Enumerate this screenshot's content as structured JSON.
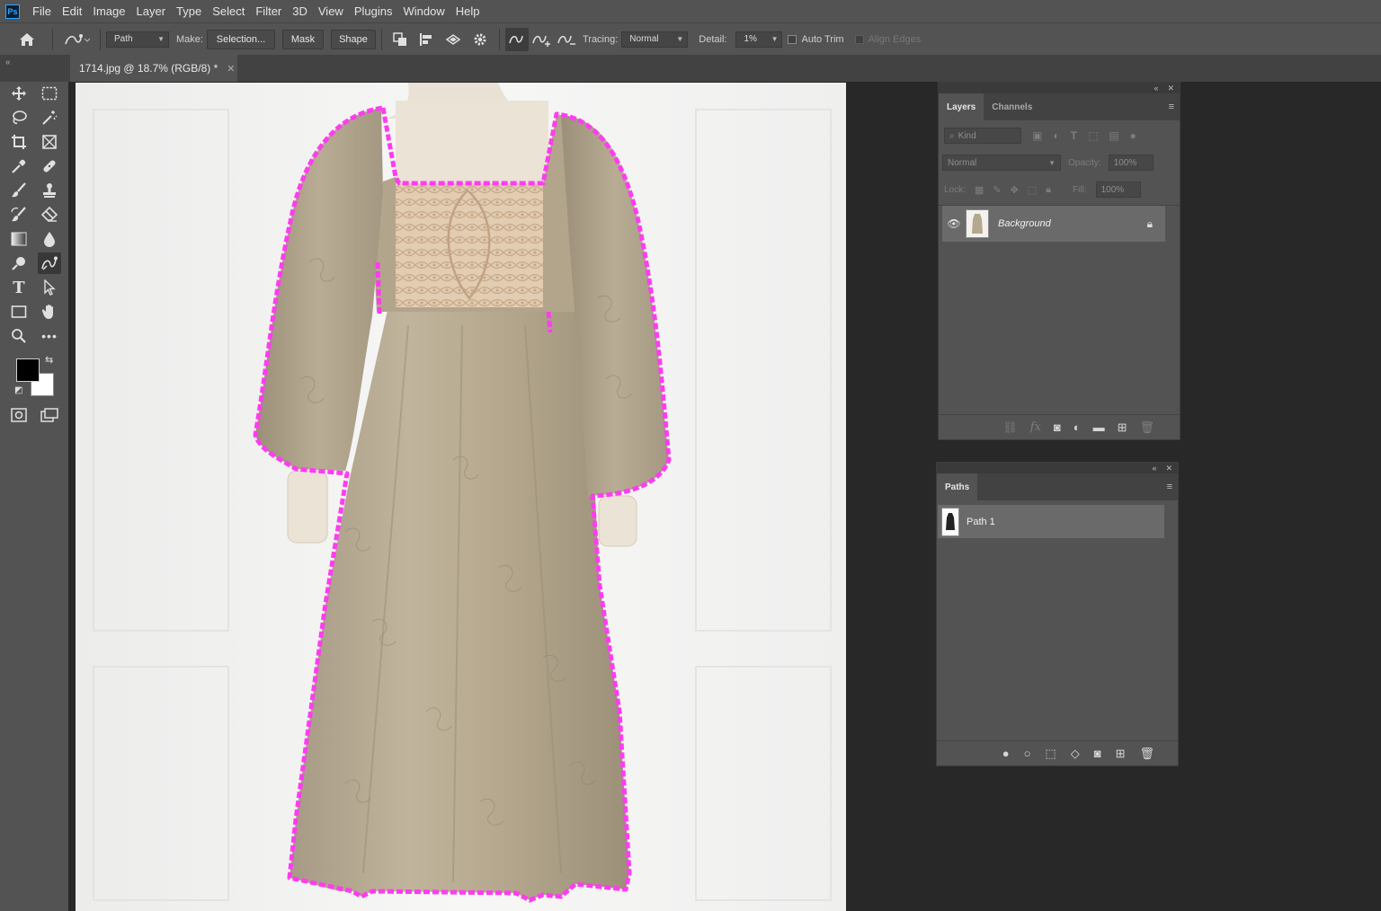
{
  "app": {
    "logo": "Ps"
  },
  "menu": [
    "File",
    "Edit",
    "Image",
    "Layer",
    "Type",
    "Select",
    "Filter",
    "3D",
    "View",
    "Plugins",
    "Window",
    "Help"
  ],
  "options": {
    "mode_value": "Path",
    "make_label": "Make:",
    "selection_button": "Selection...",
    "mask_button": "Mask",
    "shape_button": "Shape",
    "tracing_label": "Tracing:",
    "tracing_value": "Normal",
    "detail_label": "Detail:",
    "detail_value": "1%",
    "auto_trim_label": "Auto Trim",
    "auto_trim_checked": false,
    "align_edges_label": "Align Edges",
    "align_edges_checked": false
  },
  "document": {
    "tab_title": "1714.jpg @ 18.7% (RGB/8) *",
    "path_color": "#ff3cf0"
  },
  "layers_panel": {
    "tabs": [
      "Layers",
      "Channels"
    ],
    "active_tab": "Layers",
    "filter_placeholder": "Kind",
    "blend_mode": "Normal",
    "opacity_label": "Opacity:",
    "opacity_value": "100%",
    "lock_label": "Lock:",
    "fill_label": "Fill:",
    "fill_value": "100%",
    "layers": [
      {
        "name": "Background",
        "visible": true,
        "locked": true
      }
    ]
  },
  "paths_panel": {
    "tab": "Paths",
    "paths": [
      {
        "name": "Path 1"
      }
    ]
  },
  "colors": {
    "foreground": "#000000",
    "background": "#ffffff",
    "ui_panel": "#535353",
    "ui_dark": "#282828"
  }
}
